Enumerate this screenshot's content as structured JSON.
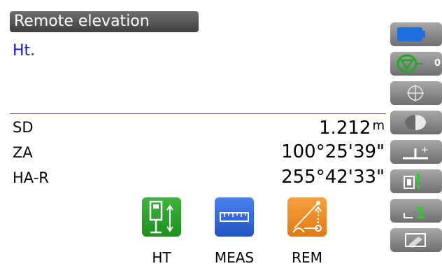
{
  "title": "Remote elevation",
  "field": {
    "label": "Ht."
  },
  "measurements": [
    {
      "label": "SD",
      "value": "1.212",
      "unit": "m"
    },
    {
      "label": "ZA",
      "value": "100°25'39\"",
      "unit": ""
    },
    {
      "label": "HA-R",
      "value": "255°42'33\"",
      "unit": ""
    }
  ],
  "sidebar": {
    "battery_icon": "battery-icon",
    "target_count": "0",
    "laser_level": "1"
  },
  "softkeys": [
    {
      "label": "HT",
      "icon": "height-icon",
      "color": "#2e9e2e"
    },
    {
      "label": "MEAS",
      "icon": "ruler-icon",
      "color": "#2f64d8"
    },
    {
      "label": "REM",
      "icon": "remote-elevation-icon",
      "color": "#f08a1c"
    }
  ],
  "colors": {
    "label_blue": "#1414c8",
    "title_bar": "#5a5a5a",
    "sidebar_gray": "#8c8c8c"
  }
}
